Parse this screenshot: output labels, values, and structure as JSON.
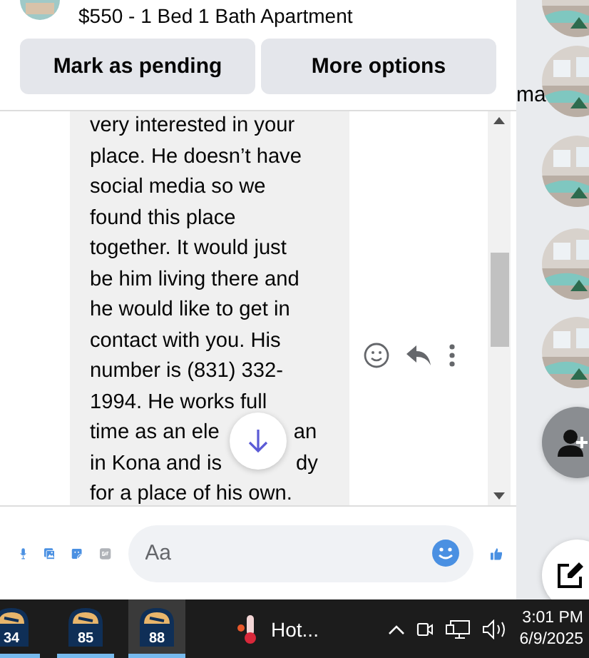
{
  "listing": {
    "title": "$550 - 1 Bed 1 Bath Apartment"
  },
  "actions": [
    "Mark as pending",
    "More options"
  ],
  "message": {
    "lines": [
      {
        "left": "very interested in your"
      },
      {
        "left": "place. He doesn’t have"
      },
      {
        "left": "social media so we"
      },
      {
        "left": "found this place"
      },
      {
        "left": "together. It would just"
      },
      {
        "left": "be him living there and"
      },
      {
        "left": "he would like to get in"
      },
      {
        "left": "contact with you. His"
      },
      {
        "left": "number is (831) 332-"
      },
      {
        "left": "1994. He works full"
      },
      {
        "left": "time as an ele",
        "right": "an"
      },
      {
        "left": "in Kona and is",
        "right": "dy"
      },
      {
        "left": "for a place of his own."
      }
    ]
  },
  "composer": {
    "placeholder": "Aa"
  },
  "side": {
    "partial_name": "ma"
  },
  "taskbar": {
    "apps": [
      {
        "label": "34",
        "selected": false
      },
      {
        "label": "85",
        "selected": false
      },
      {
        "label": "88",
        "selected": true
      }
    ],
    "weather": "Hot...",
    "time": "3:01 PM",
    "date": "6/9/2025"
  }
}
